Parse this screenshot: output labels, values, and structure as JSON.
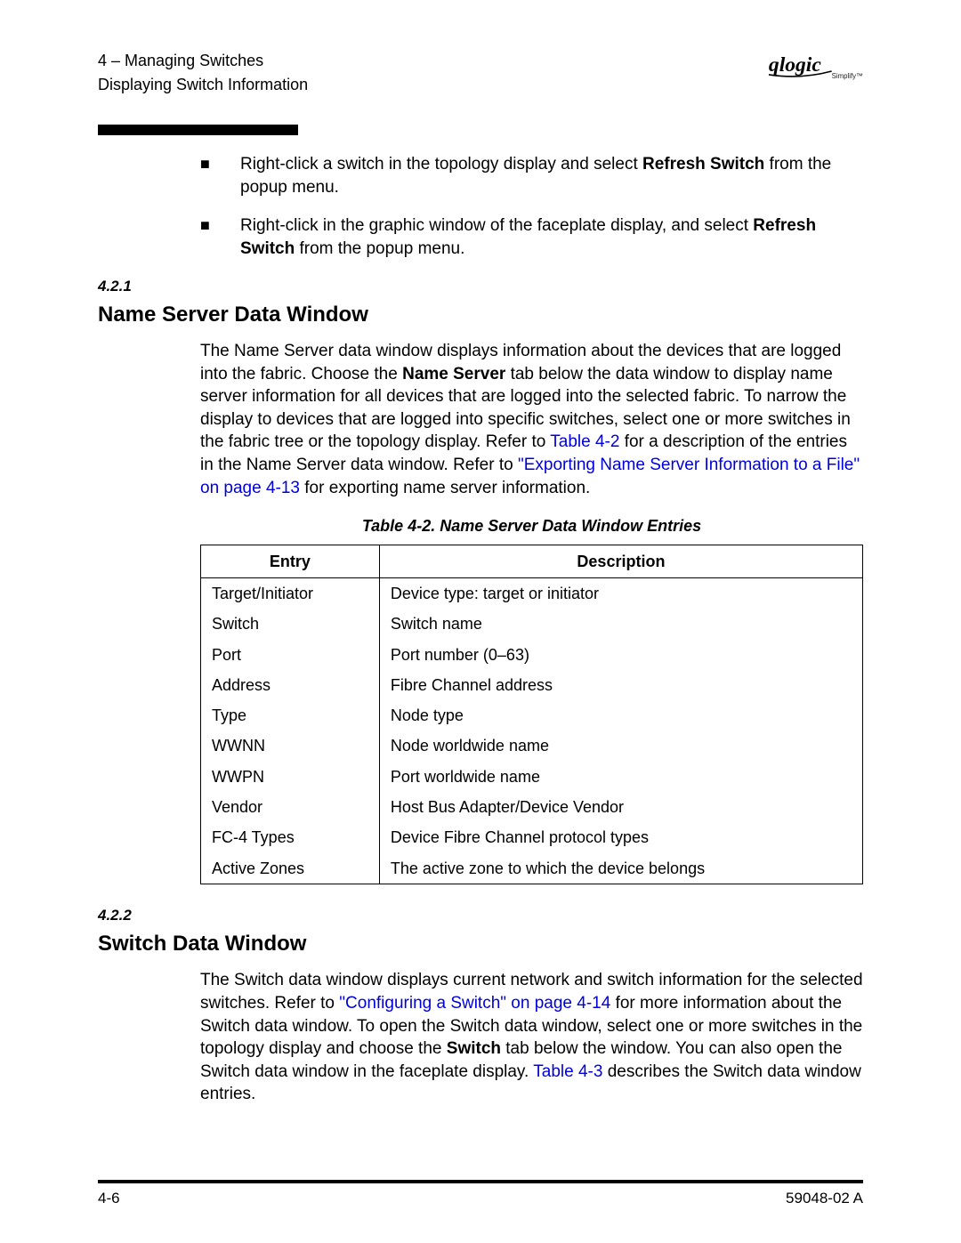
{
  "header": {
    "section_crumb": "4 – Managing Switches",
    "subsection_crumb": "Displaying Switch Information",
    "logo_alt": "qlogic Simplify"
  },
  "bullets": [
    {
      "pre": "Right-click a switch in the topology display and select ",
      "bold": "Refresh Switch",
      "post": " from the popup menu."
    },
    {
      "pre": "Right-click in the graphic window of the faceplate display, and select ",
      "bold": "Refresh Switch",
      "post": " from the popup menu."
    }
  ],
  "section1": {
    "num": "4.2.1",
    "title": "Name Server Data Window",
    "para_pre": "The Name Server data window displays information about the devices that are logged into the fabric. Choose the ",
    "para_bold1": "Name Server",
    "para_mid1": " tab below the data window to display name server information for all devices that are logged into the selected fabric. To narrow the display to devices that are logged into specific switches, select one or more switches in the fabric tree or the topology display. Refer to ",
    "link1": "Table 4-2",
    "para_mid2": " for a description of the entries in the Name Server data window. Refer to ",
    "link2": "\"Exporting Name Server Information to a File\" on page 4-13",
    "para_post": " for exporting name server information."
  },
  "table": {
    "caption": "Table 4-2. Name Server Data Window Entries",
    "head_entry": "Entry",
    "head_desc": "Description",
    "rows": [
      {
        "entry": "Target/Initiator",
        "desc": "Device type: target or initiator"
      },
      {
        "entry": "Switch",
        "desc": "Switch name"
      },
      {
        "entry": "Port",
        "desc": "Port number (0–63)"
      },
      {
        "entry": "Address",
        "desc": "Fibre Channel address"
      },
      {
        "entry": "Type",
        "desc": "Node type"
      },
      {
        "entry": "WWNN",
        "desc": "Node worldwide name"
      },
      {
        "entry": "WWPN",
        "desc": "Port worldwide name"
      },
      {
        "entry": "Vendor",
        "desc": "Host Bus Adapter/Device Vendor"
      },
      {
        "entry": "FC-4 Types",
        "desc": "Device Fibre Channel protocol types"
      },
      {
        "entry": "Active Zones",
        "desc": "The active zone to which the device belongs"
      }
    ]
  },
  "section2": {
    "num": "4.2.2",
    "title": "Switch Data Window",
    "para_pre": "The Switch data window displays current network and switch information for the selected switches. Refer to ",
    "link1": "\"Configuring a Switch\" on page 4-14",
    "para_mid1": " for more information about the Switch data window. To open the Switch data window, select one or more switches in the topology display and choose the ",
    "bold1": "Switch",
    "para_mid2": " tab below the window. You can also open the Switch data window in the faceplate display. ",
    "link2": "Table 4-3",
    "para_post": " describes the Switch data window entries."
  },
  "footer": {
    "left": "4-6",
    "right": "59048-02 A"
  }
}
